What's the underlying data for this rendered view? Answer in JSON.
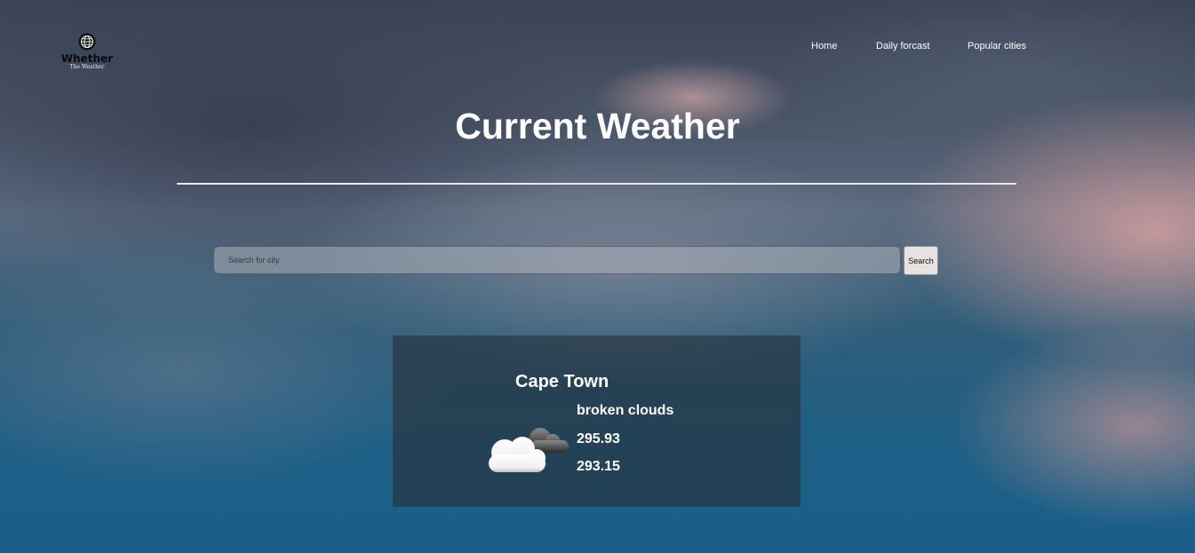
{
  "logo": {
    "icon": "globe-icon",
    "title": "Whether",
    "subtitle": "The Weather"
  },
  "nav": {
    "items": [
      {
        "label": "Home"
      },
      {
        "label": "Daily forcast"
      },
      {
        "label": "Popular cities"
      }
    ]
  },
  "main": {
    "title": "Current Weather"
  },
  "search": {
    "placeholder": "Search for city",
    "value": "",
    "button_label": "Search"
  },
  "weather": {
    "city": "Cape Town",
    "icon": "broken-clouds-icon",
    "description": "broken clouds",
    "values": [
      "295.93",
      "293.15"
    ]
  },
  "colors": {
    "text": "#ffffff",
    "card_bg": "#283038",
    "divider": "#e8e8e8"
  }
}
